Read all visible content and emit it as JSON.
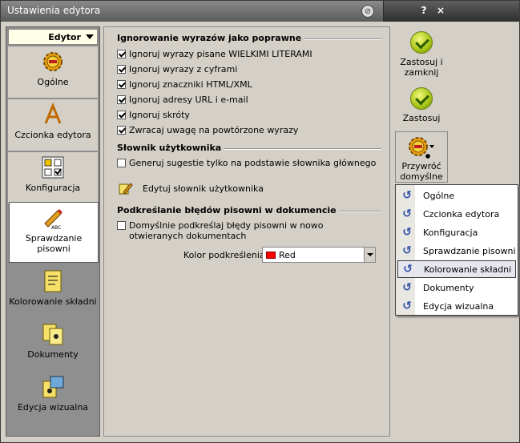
{
  "window": {
    "title": "Ustawienia edytora",
    "help_label": "?",
    "close_label": "×"
  },
  "leftnav": {
    "dropdown_label": "Edytor",
    "items": [
      {
        "label": "Ogólne",
        "icon": "gear-icon"
      },
      {
        "label": "Czcionka edytora",
        "icon": "font-icon"
      },
      {
        "label": "Konfiguracja",
        "icon": "checklist-icon"
      },
      {
        "label": "Sprawdzanie pisowni",
        "icon": "pen-abc-icon"
      },
      {
        "label": "Kolorowanie składni",
        "icon": "document-highlight-icon"
      },
      {
        "label": "Dokumenty",
        "icon": "documents-icon"
      },
      {
        "label": "Edycja wizualna",
        "icon": "visual-edit-icon"
      }
    ]
  },
  "content": {
    "section1": {
      "title": "Ignorowanie wyrazów jako poprawne",
      "options": [
        {
          "label": "Ignoruj wyrazy pisane WIELKIMI LITERAMI",
          "checked": true
        },
        {
          "label": "Ignoruj wyrazy z cyframi",
          "checked": true
        },
        {
          "label": "Ignoruj znaczniki HTML/XML",
          "checked": true
        },
        {
          "label": "Ignoruj adresy URL i e-mail",
          "checked": true
        },
        {
          "label": "Ignoruj skróty",
          "checked": true
        },
        {
          "label": "Zwracaj uwagę na powtórzone wyrazy",
          "checked": true
        }
      ]
    },
    "section2": {
      "title": "Słownik użytkownika",
      "option": {
        "label": "Generuj sugestie tylko na podstawie słownika głównego",
        "checked": false
      },
      "edit_link": "Edytuj słownik użytkownika"
    },
    "section3": {
      "title": "Podkreślanie błędów pisowni w dokumencie",
      "option": {
        "label": "Domyślnie podkreślaj błędy pisowni w nowo otwieranych dokumentach",
        "checked": false
      },
      "color_label": "Kolor podkreślenia:",
      "color_value": "Red",
      "color_hex": "#ff0000"
    }
  },
  "actions": {
    "apply_close": "Zastosuj i zamknij",
    "apply": "Zastosuj",
    "restore": "Przywróć domyślne"
  },
  "restore_menu": {
    "items": [
      "Ogólne",
      "Czcionka edytora",
      "Konfiguracja",
      "Sprawdzanie pisowni",
      "Kolorowanie składni",
      "Dokumenty",
      "Edycja wizualna"
    ],
    "highlighted": "Kolorowanie składni"
  }
}
